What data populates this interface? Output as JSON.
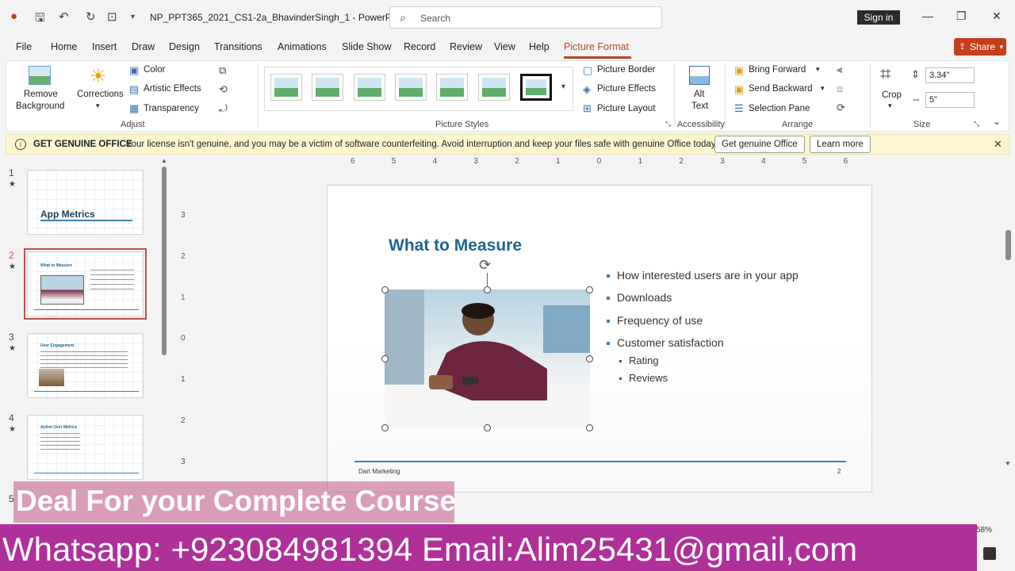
{
  "titlebar": {
    "doc_title": "NP_PPT365_2021_CS1-2a_BhavinderSingh_1  -  PowerP...",
    "search_placeholder": "Search",
    "sign_in": "Sign in"
  },
  "tabs": [
    "File",
    "Home",
    "Insert",
    "Draw",
    "Design",
    "Transitions",
    "Animations",
    "Slide Show",
    "Record",
    "Review",
    "View",
    "Help",
    "Picture Format"
  ],
  "active_tab": "Picture Format",
  "share_label": "Share",
  "ribbon": {
    "remove_bg_1": "Remove",
    "remove_bg_2": "Background",
    "corrections": "Corrections",
    "color": "Color",
    "artistic": "Artistic Effects",
    "transparency": "Transparency",
    "adjust": "Adjust",
    "picture_styles": "Picture Styles",
    "picture_border": "Picture Border",
    "picture_effects": "Picture Effects",
    "picture_layout": "Picture Layout",
    "alt_1": "Alt",
    "alt_2": "Text",
    "accessibility": "Accessibility",
    "bring_forward": "Bring Forward",
    "send_backward": "Send Backward",
    "selection_pane": "Selection Pane",
    "arrange": "Arrange",
    "crop": "Crop",
    "height": "3.34\"",
    "width": "5\"",
    "size": "Size"
  },
  "banner": {
    "title": "GET GENUINE OFFICE",
    "message": "Your license isn't genuine, and you may be a victim of software counterfeiting. Avoid interruption and keep your files safe with genuine Office today.",
    "btn_genuine": "Get genuine Office",
    "btn_learn": "Learn more"
  },
  "thumbnails": [
    {
      "num": "1",
      "title": "App Metrics"
    },
    {
      "num": "2",
      "title": "What to Measure"
    },
    {
      "num": "3",
      "title": "User Engagement"
    },
    {
      "num": "4",
      "title": "Active User Metrics"
    },
    {
      "num": "5",
      "title": ""
    }
  ],
  "ruler_h": [
    "6",
    "5",
    "4",
    "3",
    "2",
    "1",
    "0",
    "1",
    "2",
    "3",
    "4",
    "5",
    "6"
  ],
  "ruler_v": [
    "3",
    "2",
    "1",
    "0",
    "1",
    "2",
    "3"
  ],
  "slide": {
    "title": "What to Measure",
    "bullets": [
      {
        "text": "How interested users are in your app",
        "level": 1
      },
      {
        "text": "Downloads",
        "level": 1
      },
      {
        "text": "Frequency of use",
        "level": 1
      },
      {
        "text": "Customer satisfaction",
        "level": 1
      },
      {
        "text": "Rating",
        "level": 2
      },
      {
        "text": "Reviews",
        "level": 2
      }
    ],
    "footer_left": "Dart Marketing",
    "footer_right": "2"
  },
  "overlay": {
    "deal": "Deal For your Complete Course",
    "contact": "Whatsapp: +923084981394 Email:Alim25431@gmail,com"
  },
  "status": {
    "zoom": "58%"
  },
  "colors": {
    "accent": "#b7472a",
    "share": "#c43e1c",
    "slide_title": "#1f6391",
    "overlay_pink": "#c45686",
    "overlay_purple": "#b0309a"
  }
}
